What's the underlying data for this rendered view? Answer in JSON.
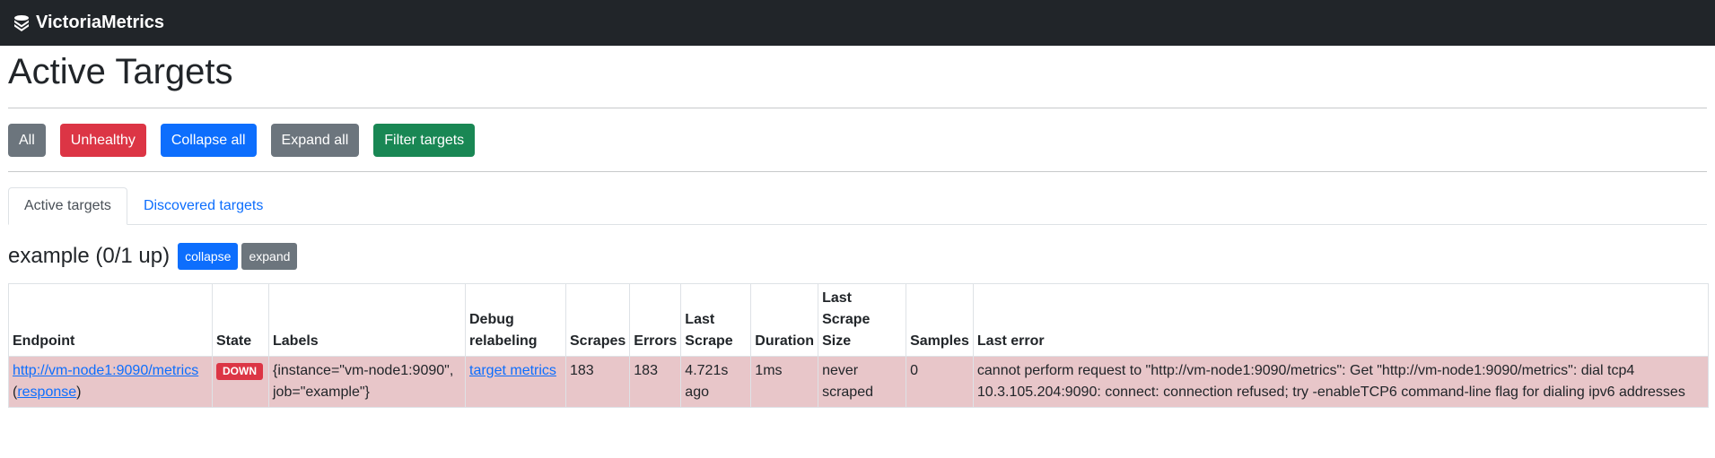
{
  "navbar": {
    "brand": "VictoriaMetrics",
    "logo_icon": "victoriametrics-logo-icon"
  },
  "page": {
    "title": "Active Targets"
  },
  "filters": {
    "all": "All",
    "unhealthy": "Unhealthy",
    "collapse_all": "Collapse all",
    "expand_all": "Expand all",
    "filter_targets": "Filter targets"
  },
  "tabs": [
    {
      "label": "Active targets",
      "active": true
    },
    {
      "label": "Discovered targets",
      "active": false
    }
  ],
  "job": {
    "title": "example (0/1 up)",
    "collapse": "collapse",
    "expand": "expand",
    "columns": {
      "endpoint": "Endpoint",
      "state": "State",
      "labels": "Labels",
      "debug_relabeling": "Debug relabeling",
      "scrapes": "Scrapes",
      "errors": "Errors",
      "last_scrape": "Last Scrape",
      "duration": "Duration",
      "last_scrape_size": "Last Scrape Size",
      "samples": "Samples",
      "last_error": "Last error"
    },
    "row": {
      "endpoint": "http://vm-node1:9090/metrics",
      "response_open": "(",
      "response": "response",
      "response_close": ")",
      "state": "DOWN",
      "labels": "{instance=\"vm-node1:9090\", job=\"example\"}",
      "debug_link": "target metrics",
      "scrapes": "183",
      "errors": "183",
      "last_scrape": "4.721s ago",
      "duration": "1ms",
      "last_scrape_size": "never scraped",
      "samples": "0",
      "last_error": "cannot perform request to \"http://vm-node1:9090/metrics\": Get \"http://vm-node1:9090/metrics\": dial tcp4 10.3.105.204:9090: connect: connection refused; try -enableTCP6 command-line flag for dialing ipv6 addresses"
    }
  }
}
